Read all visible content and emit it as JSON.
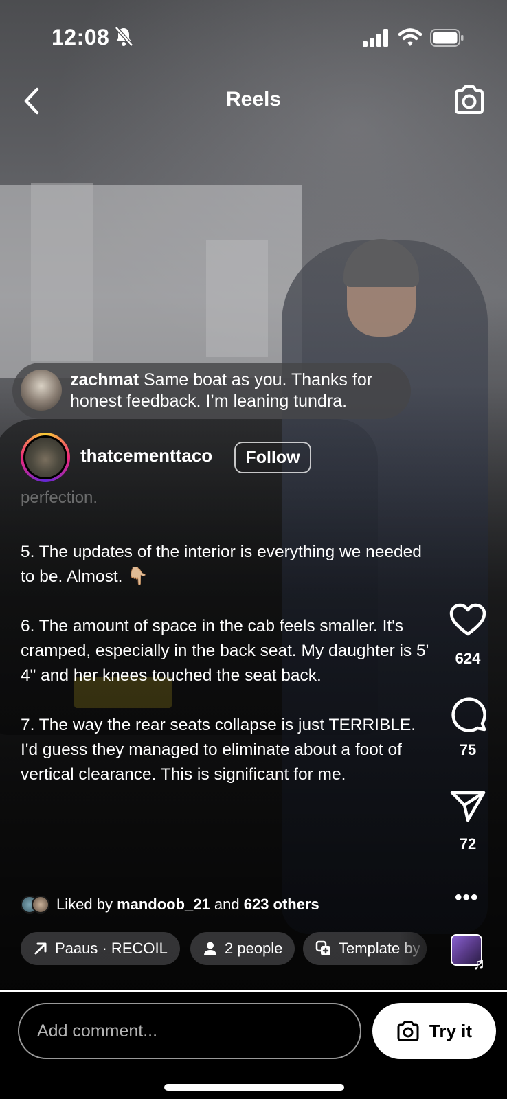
{
  "status_bar": {
    "time": "12:08"
  },
  "header": {
    "title": "Reels"
  },
  "comment_preview": {
    "username": "zachmat",
    "text": " Same boat as you. Thanks for honest feedback. I’m leaning tundra."
  },
  "author": {
    "username": "thatcementtaco",
    "follow_label": "Follow"
  },
  "caption": {
    "faded_line": "perfection.",
    "paragraphs": [
      "5. The updates of the interior is everything we needed to be. Almost. 👇🏼",
      "6. The amount of space in the cab feels smaller. It's cramped, especially in the back seat. My daughter is 5' 4\" and her knees touched the seat back.",
      "7. The way the rear seats collapse is just TERRIBLE. I'd guess they managed to eliminate about a foot of vertical clearance. This is significant for me."
    ]
  },
  "actions": {
    "likes": "624",
    "comments": "75",
    "shares": "72"
  },
  "liked_by": {
    "prefix": "Liked by ",
    "user": "mandoob_21",
    "middle": " and ",
    "others": "623 others"
  },
  "chips": {
    "audio": "Paaus · RECOIL",
    "people": "2 people",
    "template": "Template by"
  },
  "playback": {
    "progress": 1.0
  },
  "bottom": {
    "comment_placeholder": "Add comment...",
    "try_it_label": "Try it"
  }
}
